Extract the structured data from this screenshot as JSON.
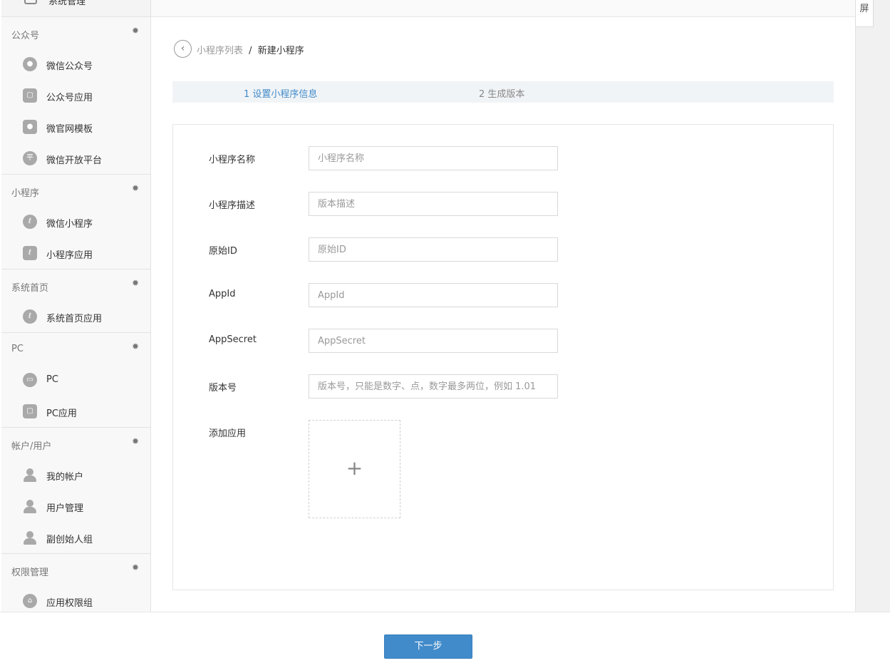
{
  "sidebar": {
    "top_item": "系统管理",
    "sections": [
      {
        "title": "公众号",
        "items": [
          {
            "label": "微信公众号",
            "icon": "wechat-icon"
          },
          {
            "label": "公众号应用",
            "icon": "bag-icon"
          },
          {
            "label": "微官网模板",
            "icon": "wechat-icon"
          },
          {
            "label": "微信开放平台",
            "icon": "platform-icon",
            "glyph": "平"
          }
        ]
      },
      {
        "title": "小程序",
        "items": [
          {
            "label": "微信小程序",
            "icon": "miniprogram-icon"
          },
          {
            "label": "小程序应用",
            "icon": "bag-icon"
          }
        ]
      },
      {
        "title": "系统首页",
        "items": [
          {
            "label": "系统首页应用",
            "icon": "miniprogram-icon"
          }
        ]
      },
      {
        "title": "PC",
        "items": [
          {
            "label": "PC",
            "icon": "monitor-icon"
          },
          {
            "label": "PC应用",
            "icon": "bag-icon"
          }
        ]
      },
      {
        "title": "帐户/用户",
        "items": [
          {
            "label": "我的帐户",
            "icon": "user-icon"
          },
          {
            "label": "用户管理",
            "icon": "users-icon"
          },
          {
            "label": "副创始人组",
            "icon": "user-settings-icon"
          }
        ]
      },
      {
        "title": "权限管理",
        "items": [
          {
            "label": "应用权限组",
            "icon": "lock-icon"
          }
        ]
      }
    ]
  },
  "right_panel": {
    "screen_label": "屏"
  },
  "breadcrumb": {
    "parent": "小程序列表",
    "separator": "/",
    "current": "新建小程序"
  },
  "steps": {
    "step1": "1 设置小程序信息",
    "step2": "2 生成版本"
  },
  "form": {
    "name_label": "小程序名称",
    "name_placeholder": "小程序名称",
    "name_value": "",
    "desc_label": "小程序描述",
    "desc_placeholder": "版本描述",
    "desc_value": "",
    "origin_label": "原始ID",
    "origin_placeholder": "原始ID",
    "origin_value": "",
    "appid_label": "AppId",
    "appid_placeholder": "AppId",
    "appid_value": "",
    "secret_label": "AppSecret",
    "secret_placeholder": "AppSecret",
    "secret_value": "",
    "version_label": "版本号",
    "version_placeholder": "版本号，只能是数字、点，数字最多两位，例如 1.01",
    "version_value": "",
    "addapp_label": "添加应用",
    "addapp_glyph": "+"
  },
  "footer": {
    "next_label": "下一步"
  },
  "colors": {
    "accent": "#428bca",
    "sidebar_bg": "#f8f8f8",
    "steps_bg": "#f1f4f7"
  }
}
